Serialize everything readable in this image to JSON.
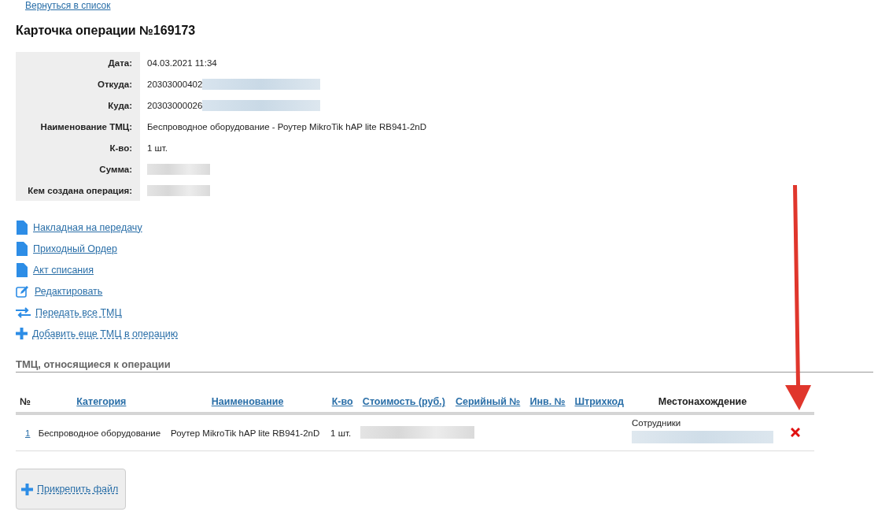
{
  "back_link": "Вернуться в список",
  "title": "Карточка операции №169173",
  "details": [
    {
      "label": "Дата:",
      "value": "04.03.2021 11:34",
      "redacted": false
    },
    {
      "label": "Откуда:",
      "value": "20303000402",
      "redacted": true
    },
    {
      "label": "Куда:",
      "value": "20303000026",
      "redacted": true
    },
    {
      "label": "Наименование ТМЦ:",
      "value": "Беспроводное оборудование - Роутер MikroTik hAP lite RB941-2nD",
      "redacted": false
    },
    {
      "label": "К-во:",
      "value": "1 шт.",
      "redacted": false
    },
    {
      "label": "Сумма:",
      "redacted": true
    },
    {
      "label": "Кем создана операция:",
      "redacted": true
    }
  ],
  "actions": [
    {
      "kind": "document",
      "label": "Накладная на передачу",
      "dashed": false
    },
    {
      "kind": "document",
      "label": "Приходный Ордер",
      "dashed": false
    },
    {
      "kind": "document",
      "label": "Акт списания",
      "dashed": false
    },
    {
      "kind": "edit",
      "label": "Редактировать",
      "dashed": false
    },
    {
      "kind": "transfer",
      "label": "Передать все ТМЦ",
      "dashed": true
    },
    {
      "kind": "add",
      "label": "Добавить еще ТМЦ в операцию",
      "dashed": true
    }
  ],
  "section_title": "ТМЦ, относящиеся к операции",
  "table": {
    "columns": [
      {
        "label": "№",
        "sortable": false
      },
      {
        "label": "Категория",
        "sortable": true
      },
      {
        "label": "Наименование",
        "sortable": true
      },
      {
        "label": "К-во",
        "sortable": true
      },
      {
        "label": "Стоимость (руб.)",
        "sortable": true
      },
      {
        "label": "Серийный №",
        "sortable": true
      },
      {
        "label": "Инв. №",
        "sortable": true
      },
      {
        "label": "Штрихкод",
        "sortable": true
      },
      {
        "label": "Местонахождение",
        "sortable": false
      }
    ],
    "rows": [
      {
        "number": "1",
        "category": "Беспроводное оборудование",
        "name": "Роутер MikroTik hAP lite RB941-2nD",
        "quantity": "1 шт.",
        "cost_redacted": true,
        "location": "Сотрудники",
        "location_redacted": true,
        "deletable": true
      }
    ]
  },
  "attach_button": "Прикрепить файл",
  "annotation_arrow": true
}
